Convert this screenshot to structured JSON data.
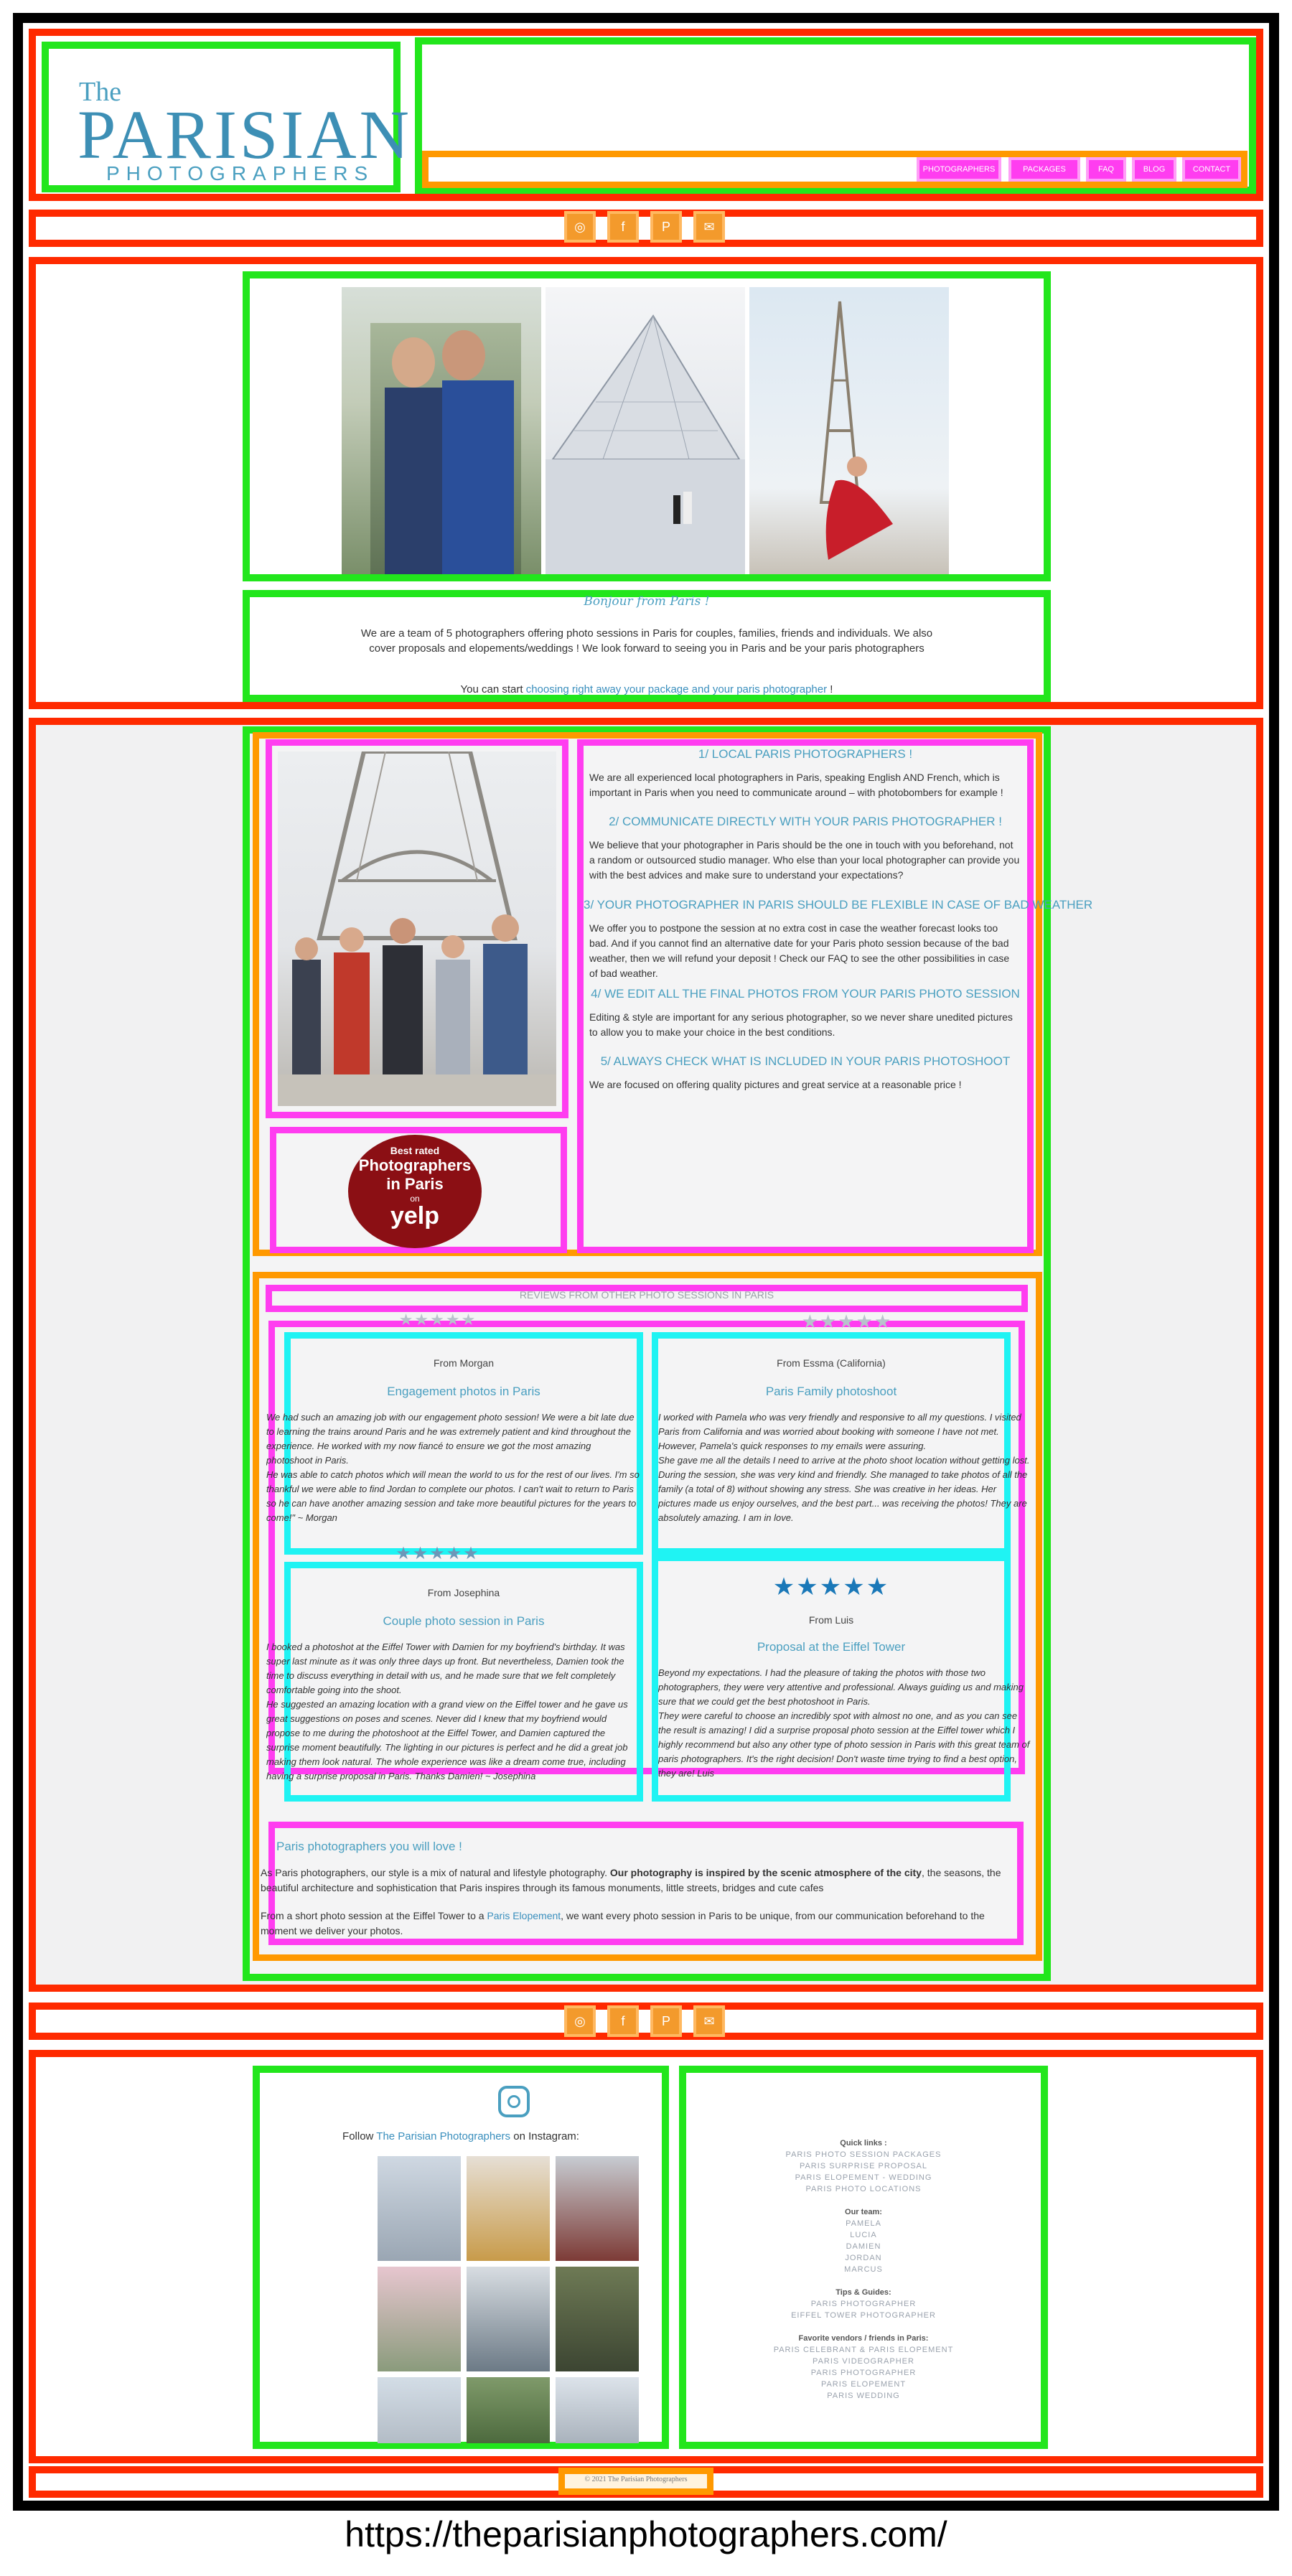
{
  "logo": {
    "the": "The",
    "main": "PARISIAN",
    "sub": "PHOTOGRAPHERS"
  },
  "nav": {
    "items": [
      "PHOTOGRAPHERS",
      "PACKAGES",
      "FAQ",
      "BLOG",
      "CONTACT"
    ]
  },
  "social_top": [
    "instagram-icon",
    "facebook-icon",
    "pinterest-icon",
    "mail-icon"
  ],
  "intro": {
    "heading": "Bonjour from Paris !",
    "text": "We are a team of 5 photographers offering photo sessions in Paris for couples, families, friends and individuals. We also cover proposals and elopements/weddings ! We look forward to seeing you in Paris and be your paris photographers",
    "cta_prefix": "You can start ",
    "cta_link": "choosing right away your package and your paris photographer",
    "cta_suffix": " !"
  },
  "badge": {
    "line1": "Best rated",
    "line2": "Photographers",
    "line3": "in Paris",
    "line4": "on",
    "brand": "yelp"
  },
  "points": [
    {
      "title": "1/ LOCAL PARIS PHOTOGRAPHERS !",
      "text": "We are all experienced local photographers in Paris, speaking English AND French, which is important in Paris when you need to communicate around – with photobombers for example !"
    },
    {
      "title": "2/ COMMUNICATE DIRECTLY WITH YOUR PARIS PHOTOGRAPHER !",
      "text": "We believe that your photographer in Paris should be the one in touch with you beforehand, not a random or outsourced studio manager. Who else than your local photographer can provide you with the best advices and make sure to understand your expectations?"
    },
    {
      "title": "3/ YOUR PHOTOGRAPHER IN PARIS SHOULD BE FLEXIBLE IN CASE OF BAD WEATHER",
      "text": "We offer you to postpone the session at no extra cost in case the weather forecast looks too bad. And if you cannot find an alternative date for your Paris photo session because of the bad weather, then we will refund your deposit ! Check our FAQ to see the other possibilities in case of bad weather."
    },
    {
      "title": "4/ WE EDIT ALL THE FINAL PHOTOS FROM YOUR PARIS PHOTO SESSION",
      "text": "Editing & style are important for any serious photographer, so we never share unedited pictures to allow you to make your choice in the best conditions."
    },
    {
      "title": "5/ ALWAYS CHECK WHAT IS INCLUDED IN YOUR PARIS PHOTOSHOOT",
      "text": "We are focused on offering quality pictures and great service at a reasonable price !"
    }
  ],
  "reviews_heading": "REVIEWS FROM OTHER PHOTO SESSIONS IN PARIS",
  "reviews": [
    {
      "from": "From Morgan",
      "title": "Engagement photos in Paris",
      "stars": "★★★★★",
      "text": "We had such an amazing job with our engagement photo session! We were a bit late due to learning the trains around Paris and he was extremely patient and kind throughout the experience. He worked with my now fiancé to ensure we got the most amazing photoshoot in Paris.\nHe was able to catch photos which will mean the world to us for the rest of our lives. I'm so thankful we were able to find Jordan to complete our photos. I can't wait to return to Paris so he can have another amazing session and take more beautiful pictures for the years to come!\" ~ Morgan"
    },
    {
      "from": "From Essma (California)",
      "title": "Paris Family photoshoot",
      "stars": "★★★★★",
      "text": "I worked with Pamela who was very friendly and responsive to all my questions. I visited Paris from California and was worried about booking with someone I have not met. However, Pamela's quick responses to my emails were assuring.\nShe gave me all the details I need to arrive at the photo shoot location without getting lost. During the session, she was very kind and friendly. She managed to take photos of all the family (a total of 8) without showing any stress. She was creative in her ideas. Her pictures made us enjoy ourselves, and the best part... was receiving the photos! They are absolutely amazing. I am in love."
    },
    {
      "from": "From Josephina",
      "title": "Couple photo session in Paris",
      "stars": "★★★★★",
      "text": "I booked a photoshot at the Eiffel Tower with Damien for my boyfriend's birthday. It was super last minute as it was only three days up front. But nevertheless, Damien took the time to discuss everything in detail with us, and he made sure that we felt completely comfortable going into the shoot.\nHe suggested an amazing location with a grand view on the Eiffel tower and he gave us great suggestions on poses and scenes. Never did I knew that my boyfriend would propose to me during the photoshoot at the Eiffel Tower, and Damien captured the surprise moment beautifully. The lighting in our pictures is perfect and he did a great job making them look natural. The whole experience was like a dream come true, including having a surprise proposal in Paris. Thanks Damien! ~ Josephina"
    },
    {
      "from": "From Luis",
      "title": "Proposal at the Eiffel Tower",
      "stars": "★★★★★",
      "text": "Beyond my expectations. I had the pleasure of taking the photos with those two photographers, they were very attentive and professional. Always guiding us and making sure that we could get the best photoshoot in Paris.\nThey were careful to choose an incredibly spot with almost no one, and as you can see the result is amazing! I did a surprise proposal photo session at the Eiffel tower which I highly recommend but also any other type of photo session in Paris with this great team of paris photographers. It's the right decision! Don't waste time trying to find a best option, they are! Luis"
    }
  ],
  "love": {
    "title": "Paris photographers you will love !",
    "p1_start": "As Paris photographers, our style is a mix of natural and lifestyle photography. ",
    "p1_bold": "Our photography is inspired by the scenic atmosphere of the city",
    "p1_end": ", the seasons, the beautiful architecture and sophistication that Paris inspires through its famous monuments, little streets, bridges and cute cafes",
    "p2_start": "From a short photo session at the Eiffel Tower to a ",
    "p2_link": "Paris Elopement",
    "p2_end": ", we want every photo session in Paris to be unique, from our communication beforehand to the moment we deliver your photos."
  },
  "social_bottom": [
    "instagram-icon",
    "facebook-icon",
    "pinterest-icon",
    "mail-icon"
  ],
  "instagram": {
    "prefix": "Follow ",
    "link": "The Parisian Photographers",
    "suffix": " on Instagram:"
  },
  "footer_links": {
    "quick_head": "Quick links :",
    "quick": [
      "PARIS PHOTO SESSION PACKAGES",
      "PARIS SURPRISE PROPOSAL",
      "PARIS ELOPEMENT - WEDDING",
      "PARIS PHOTO LOCATIONS"
    ],
    "team_head": "Our team:",
    "team": [
      "PAMELA",
      "LUCIA",
      "DAMIEN",
      "JORDAN",
      "MARCUS"
    ],
    "tips_head": "Tips & Guides:",
    "tips": [
      "PARIS PHOTOGRAPHER",
      "EIFFEL TOWER PHOTOGRAPHER"
    ],
    "vendors_head": "Favorite vendors / friends in Paris:",
    "vendors": [
      "PARIS CELEBRANT & PARIS ELOPEMENT",
      "PARIS VIDEOGRAPHER",
      "PARIS PHOTOGRAPHER",
      "PARIS ELOPEMENT",
      "PARIS WEDDING"
    ]
  },
  "copyright": "© 2021 The Parisian Photographers",
  "url_caption": "https://theparisianphotographers.com/",
  "colors": {
    "red": "#ff2a00",
    "green": "#22e61c",
    "orange": "#ff9900",
    "magenta": "#ff3df0",
    "cyan": "#1ff3f3",
    "teal": "#4a9fc0"
  }
}
